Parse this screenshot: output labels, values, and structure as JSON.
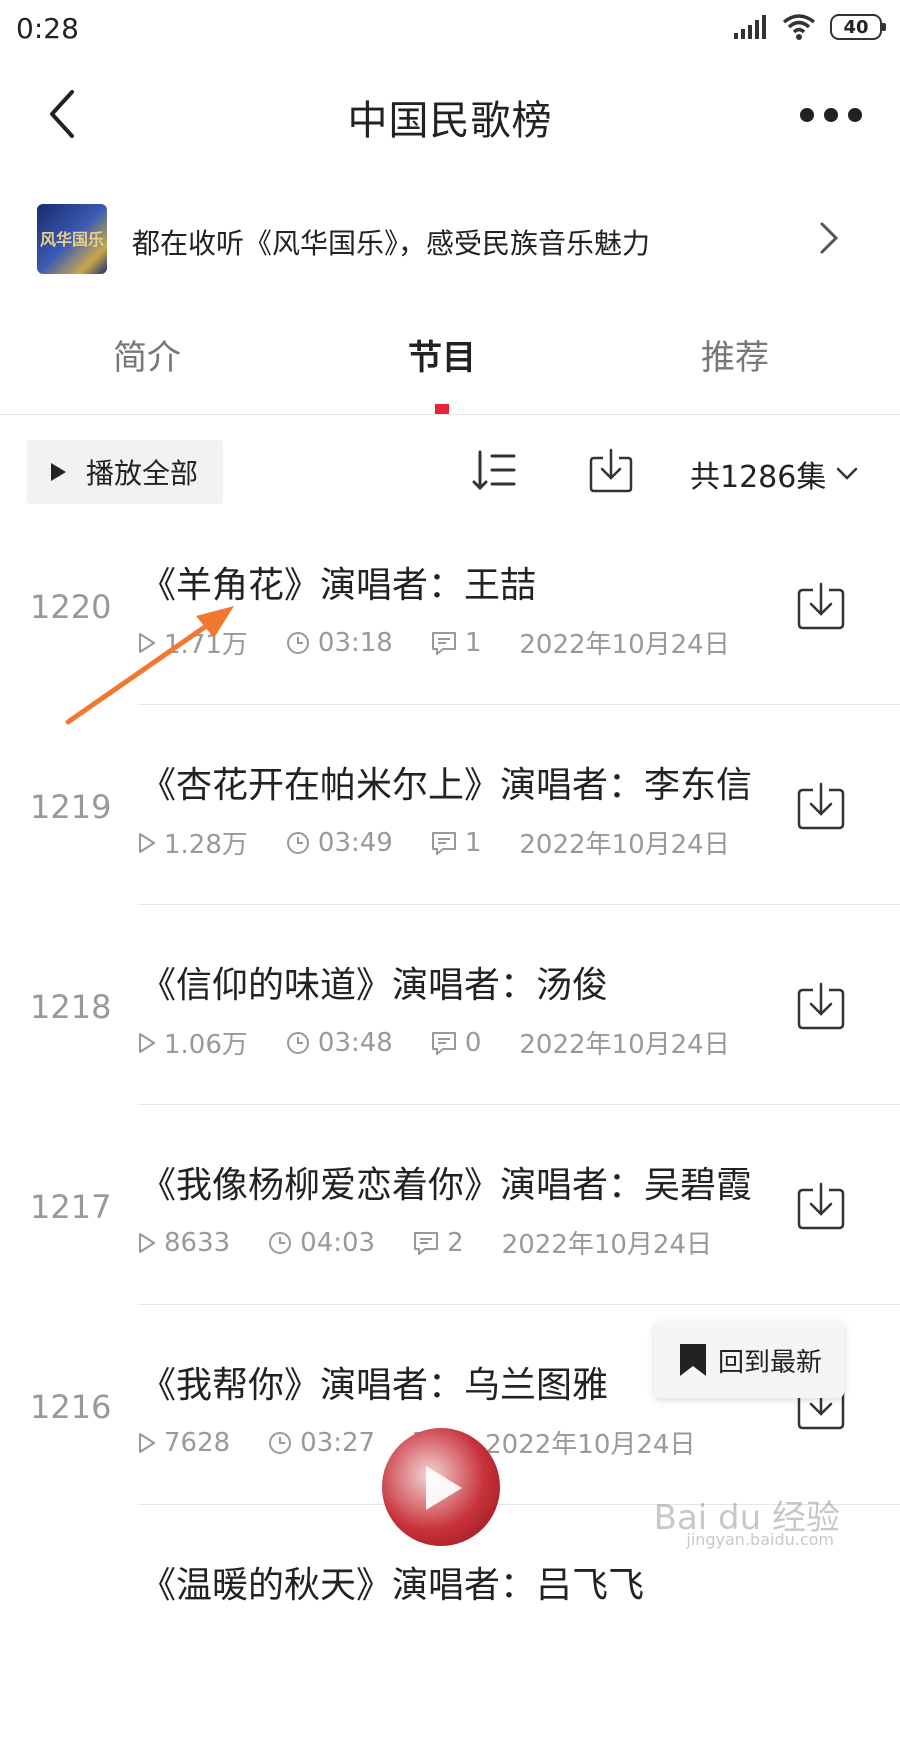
{
  "status_bar": {
    "time": "0:28",
    "battery": "40"
  },
  "header": {
    "title": "中国民歌榜"
  },
  "banner": {
    "text": "都在收听《风华国乐》，感受民族音乐魅力",
    "thumb_text": "风华国乐"
  },
  "tabs": [
    {
      "label": "简介",
      "active": false
    },
    {
      "label": "节目",
      "active": true
    },
    {
      "label": "推荐",
      "active": false
    }
  ],
  "toolbar": {
    "play_all_label": "播放全部",
    "count_label": "共1286集"
  },
  "episodes": [
    {
      "num": "1220",
      "title": "《羊角花》演唱者：王喆",
      "plays": "1.71万",
      "duration": "03:18",
      "comments": "1",
      "date": "2022年10月24日"
    },
    {
      "num": "1219",
      "title": "《杏花开在帕米尔上》演唱者：李东信",
      "plays": "1.28万",
      "duration": "03:49",
      "comments": "1",
      "date": "2022年10月24日"
    },
    {
      "num": "1218",
      "title": "《信仰的味道》演唱者：汤俊",
      "plays": "1.06万",
      "duration": "03:48",
      "comments": "0",
      "date": "2022年10月24日"
    },
    {
      "num": "1217",
      "title": "《我像杨柳爱恋着你》演唱者：吴碧霞",
      "plays": "8633",
      "duration": "04:03",
      "comments": "2",
      "date": "2022年10月24日"
    },
    {
      "num": "1216",
      "title": "《我帮你》演唱者：乌兰图雅",
      "plays": "7628",
      "duration": "03:27",
      "comments": "",
      "date": "2022年10月24日"
    },
    {
      "num": "",
      "title": "《温暖的秋天》演唱者：吕飞飞",
      "plays": "",
      "duration": "",
      "comments": "",
      "date": ""
    }
  ],
  "floating": {
    "back_to_latest": "回到最新"
  },
  "watermark": {
    "main": "Bai du 经验",
    "sub": "jingyan.baidu.com"
  },
  "colors": {
    "accent": "#e8213c",
    "annotation_arrow": "#f07830"
  },
  "icons": [
    "back-icon",
    "more-icon",
    "chevron-right-icon",
    "play-icon",
    "sort-icon",
    "download-icon",
    "chevron-down-icon",
    "clock-icon",
    "comment-icon",
    "bookmark-icon"
  ]
}
